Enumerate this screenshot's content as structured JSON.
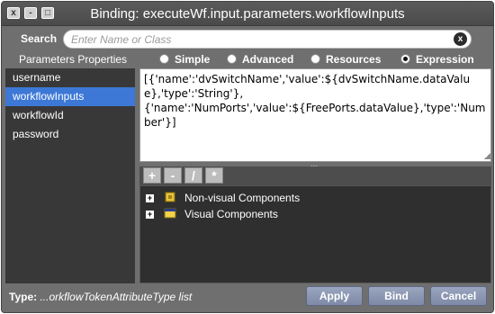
{
  "window": {
    "title": "Binding: executeWf.input.parameters.workflowInputs",
    "controls": {
      "close": "x",
      "minimize": "-",
      "maximize": "□"
    }
  },
  "search": {
    "label": "Search",
    "placeholder": "Enter Name or Class",
    "clear_glyph": "x"
  },
  "params_label": "Parameters Properties",
  "modes": [
    {
      "label": "Simple",
      "selected": false
    },
    {
      "label": "Advanced",
      "selected": false
    },
    {
      "label": "Resources",
      "selected": false
    },
    {
      "label": "Expression",
      "selected": true
    }
  ],
  "parameters": [
    {
      "label": "username",
      "selected": false
    },
    {
      "label": "workflowInputs",
      "selected": true
    },
    {
      "label": "workflowId",
      "selected": false
    },
    {
      "label": "password",
      "selected": false
    }
  ],
  "expression": "[{'name':'dvSwitchName','value':${dvSwitchName.dataValue},'type':'String'},\n{'name':'NumPorts','value':${FreePorts.dataValue},'type':'Number'}]",
  "toolbar": {
    "add": "+",
    "remove": "-",
    "divide": "/",
    "multiply": "*"
  },
  "tree": [
    {
      "label": "Non-visual Components",
      "expander": "+"
    },
    {
      "label": "Visual Components",
      "expander": "+"
    }
  ],
  "footer": {
    "type_label": "Type:",
    "type_value": "...orkflowTokenAttributeType list",
    "apply": "Apply",
    "bind": "Bind",
    "cancel": "Cancel"
  },
  "colors": {
    "selection": "#3d78d6",
    "dialog_bg": "#6f6f6f",
    "list_bg": "#383838"
  }
}
